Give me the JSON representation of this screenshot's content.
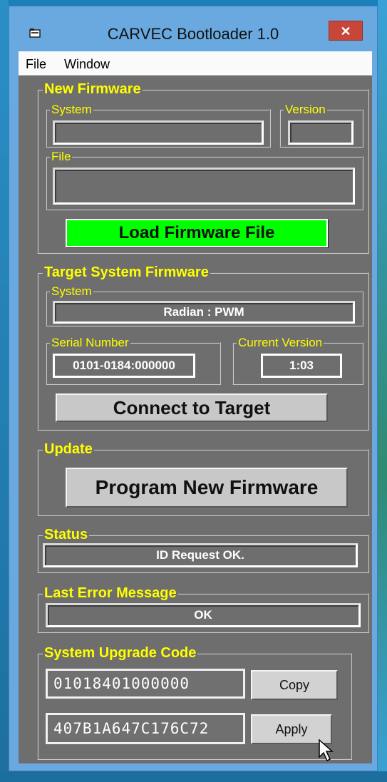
{
  "window": {
    "title": "CARVEC Bootloader 1.0",
    "close_glyph": "✕"
  },
  "menu": {
    "file": "File",
    "window": "Window"
  },
  "new_firmware": {
    "legend": "New Firmware",
    "system_label": "System",
    "system_value": "",
    "version_label": "Version",
    "version_value": "",
    "file_label": "File",
    "file_value": "",
    "load_button": "Load Firmware File"
  },
  "target": {
    "legend": "Target System Firmware",
    "system_label": "System",
    "system_value": "Radian : PWM",
    "serial_label": "Serial Number",
    "serial_value": "0101-0184:000000",
    "current_version_label": "Current Version",
    "current_version_value": "1:03",
    "connect_button": "Connect to Target"
  },
  "update": {
    "legend": "Update",
    "program_button": "Program New Firmware"
  },
  "status": {
    "legend": "Status",
    "value": "ID Request OK."
  },
  "last_error": {
    "legend": "Last Error Message",
    "value": "OK"
  },
  "upgrade_code": {
    "legend": "System Upgrade Code",
    "code_value": "01018401000000",
    "copy_button": "Copy",
    "apply_value": "407B1A647C176C72",
    "apply_button": "Apply"
  },
  "colors": {
    "legend": "#ffff00",
    "panel": "#6e6e6e",
    "load_button": "#00ff00",
    "close": "#c7463a"
  },
  "icons": [
    "app-icon",
    "close-icon",
    "mouse-cursor-icon"
  ]
}
